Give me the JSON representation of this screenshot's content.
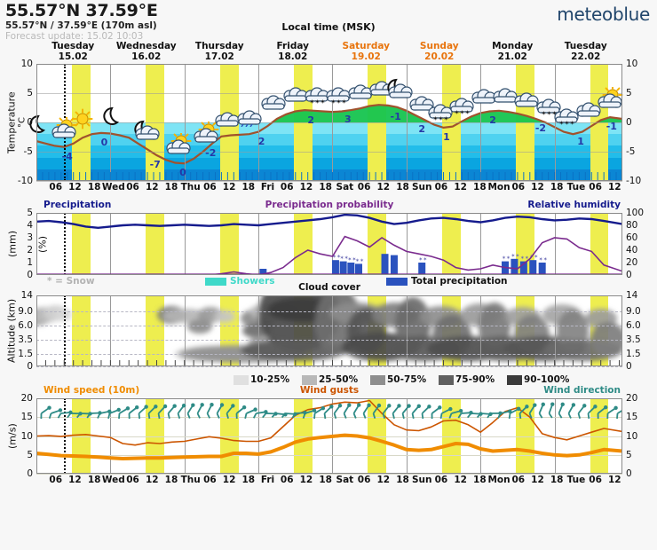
{
  "header": {
    "coordinates_main": "55.57°N 37.59°E",
    "coordinates_sub": "55.57°N / 37.59°E (170m asl)",
    "forecast_update": "Forecast update: 15.02 10:03",
    "local_time": "Local time (MSK)",
    "logo": "meteoblue"
  },
  "days": [
    {
      "name": "Tuesday",
      "date": "15.02",
      "weekend": false
    },
    {
      "name": "Wednesday",
      "date": "16.02",
      "weekend": false
    },
    {
      "name": "Thursday",
      "date": "17.02",
      "weekend": false
    },
    {
      "name": "Friday",
      "date": "18.02",
      "weekend": false
    },
    {
      "name": "Saturday",
      "date": "19.02",
      "weekend": true
    },
    {
      "name": "Sunday",
      "date": "20.02",
      "weekend": true
    },
    {
      "name": "Monday",
      "date": "21.02",
      "weekend": false
    },
    {
      "name": "Tuesday",
      "date": "22.02",
      "weekend": false
    }
  ],
  "xaxis": {
    "labels": [
      "06",
      "12",
      "18",
      "Wed",
      "06",
      "12",
      "18",
      "Thu",
      "06",
      "12",
      "18",
      "Fri",
      "06",
      "12",
      "18",
      "Sat",
      "06",
      "12",
      "18",
      "Sun",
      "06",
      "12",
      "18",
      "Mon",
      "06",
      "12",
      "18",
      "Tue",
      "06",
      "12"
    ],
    "positions_pct": [
      6.25,
      12.5,
      18.75,
      25,
      31.25,
      37.5,
      43.75,
      50,
      56.25,
      62.5,
      68.75,
      75,
      81.25,
      87.5,
      93.75,
      100,
      106.25,
      112.5,
      118.75,
      125,
      131.25,
      137.5,
      143.75,
      150,
      156.25,
      162.5,
      168.75,
      175,
      181.25,
      187.5
    ]
  },
  "colors": {
    "weekend_text": "#e8740c",
    "night_band": "#eeee4f",
    "temp_line": "#a0522d",
    "temp_label": "#2438a8",
    "humidity_line": "#151b8d",
    "precip_prob_line": "#7a2b8e",
    "precip_bar": "#2a52be",
    "showers": "#3fd9c9",
    "wind_speed": "#f08c00",
    "wind_gust": "#cc5500",
    "wind_barb": "#2e8b86",
    "logo": "#20456b"
  },
  "chart_data": [
    {
      "type": "line",
      "name": "temperature",
      "title": "Temperature",
      "ylabel": "Temperature",
      "yunit": "°C",
      "ylim": [
        -10,
        10
      ],
      "yticks": [
        -10,
        -5,
        0,
        5,
        10
      ],
      "ytick_labels": [
        "-10",
        "-5",
        "0",
        "5",
        "10"
      ],
      "xlabel": "",
      "grid": true,
      "legend": "none",
      "point_labels": [
        {
          "x_pct": 10.0,
          "value": "-4"
        },
        {
          "x_pct": 22.0,
          "value": "0"
        },
        {
          "x_pct": 38.5,
          "value": "-7"
        },
        {
          "x_pct": 47.5,
          "value": "0"
        },
        {
          "x_pct": 56.5,
          "value": "-2"
        },
        {
          "x_pct": 73.0,
          "value": "2"
        },
        {
          "x_pct": 89.0,
          "value": "2"
        },
        {
          "x_pct": 101.0,
          "value": "3"
        },
        {
          "x_pct": 116.5,
          "value": "-1"
        },
        {
          "x_pct": 125.0,
          "value": "2"
        },
        {
          "x_pct": 133.0,
          "value": "1"
        },
        {
          "x_pct": 148.0,
          "value": "2"
        },
        {
          "x_pct": 163.5,
          "value": "-2"
        },
        {
          "x_pct": 176.5,
          "value": "1"
        },
        {
          "x_pct": 186.5,
          "value": "-1"
        }
      ],
      "series": [
        {
          "name": "Temperature (°C)",
          "x_pct": [
            0,
            3,
            6,
            9,
            12,
            15,
            18,
            21,
            24,
            27,
            30,
            33,
            36,
            39,
            42,
            45,
            48,
            51,
            54,
            57,
            60,
            63,
            66,
            69,
            72,
            75,
            78,
            81,
            84,
            87,
            90,
            93,
            96,
            99,
            102,
            105,
            108,
            111,
            114,
            117,
            120,
            123,
            126,
            129,
            132,
            135,
            138,
            141,
            144,
            147,
            150,
            153,
            156,
            159,
            162,
            165,
            168,
            171,
            174,
            177,
            180,
            183,
            186,
            190
          ],
          "values": [
            -3.2,
            -3.6,
            -4.0,
            -4.2,
            -3.6,
            -2.6,
            -2.0,
            -1.8,
            -1.9,
            -2.2,
            -2.6,
            -3.6,
            -4.6,
            -5.6,
            -6.4,
            -6.9,
            -7.0,
            -6.2,
            -5.0,
            -3.6,
            -2.4,
            -2.2,
            -2.1,
            -2.0,
            -1.6,
            -0.6,
            0.6,
            1.4,
            1.9,
            2.1,
            2.0,
            1.9,
            1.8,
            1.9,
            2.1,
            2.4,
            2.8,
            3.0,
            2.9,
            2.6,
            2.0,
            1.2,
            0.4,
            -0.4,
            -0.9,
            -0.7,
            0.2,
            1.0,
            1.6,
            1.9,
            2.0,
            1.8,
            1.5,
            1.1,
            0.6,
            0.0,
            -0.8,
            -1.6,
            -2.0,
            -1.6,
            -0.6,
            0.4,
            0.9,
            0.6
          ]
        }
      ],
      "weather_icons": [
        {
          "x_pct": 2,
          "icon": "moon"
        },
        {
          "x_pct": 9,
          "icon": "sun-cloud"
        },
        {
          "x_pct": 15,
          "icon": "sun"
        },
        {
          "x_pct": 26,
          "icon": "moon"
        },
        {
          "x_pct": 36,
          "icon": "moon-cloud"
        },
        {
          "x_pct": 46,
          "icon": "sun-cloud"
        },
        {
          "x_pct": 55,
          "icon": "cloud-sun"
        },
        {
          "x_pct": 62,
          "icon": "cloud"
        },
        {
          "x_pct": 69,
          "icon": "cloud-rain"
        },
        {
          "x_pct": 77,
          "icon": "cloud"
        },
        {
          "x_pct": 84,
          "icon": "cloud"
        },
        {
          "x_pct": 91,
          "icon": "cloud-snow"
        },
        {
          "x_pct": 98,
          "icon": "cloud-snow"
        },
        {
          "x_pct": 105,
          "icon": "cloud"
        },
        {
          "x_pct": 112,
          "icon": "cloud"
        },
        {
          "x_pct": 118,
          "icon": "moon-cloud"
        },
        {
          "x_pct": 125,
          "icon": "cloud"
        },
        {
          "x_pct": 131,
          "icon": "cloud-snow"
        },
        {
          "x_pct": 138,
          "icon": "cloud-snow"
        },
        {
          "x_pct": 145,
          "icon": "cloud"
        },
        {
          "x_pct": 152,
          "icon": "cloud"
        },
        {
          "x_pct": 159,
          "icon": "cloud"
        },
        {
          "x_pct": 166,
          "icon": "cloud-snow"
        },
        {
          "x_pct": 172,
          "icon": "cloud-snow"
        },
        {
          "x_pct": 179,
          "icon": "cloud"
        },
        {
          "x_pct": 186,
          "icon": "sun-cloud"
        }
      ]
    },
    {
      "type": "line",
      "name": "precipitation",
      "title_left": "Precipitation",
      "title_center": "Precipitation probability",
      "title_right": "Relative humidity",
      "ylabel": "(mm)",
      "ylim": [
        0,
        5
      ],
      "yticks": [
        0,
        1,
        2,
        3,
        4,
        5
      ],
      "ytick_labels": [
        "0",
        "1",
        "2",
        "3",
        "4",
        "5"
      ],
      "y2label": "(%)",
      "y2lim": [
        0,
        100
      ],
      "y2ticks": [
        0,
        20,
        40,
        60,
        80,
        100
      ],
      "y2tick_labels": [
        "0",
        "20",
        "40",
        "60",
        "80",
        "100"
      ],
      "note": "* = Snow",
      "legend": [
        "Showers",
        "Total precipitation"
      ],
      "series": [
        {
          "name": "Relative humidity (%)",
          "color": "#151b8d",
          "x_pct": [
            0,
            4,
            8,
            12,
            16,
            20,
            24,
            28,
            32,
            36,
            40,
            44,
            48,
            52,
            56,
            60,
            64,
            68,
            72,
            76,
            80,
            84,
            88,
            92,
            96,
            100,
            104,
            108,
            112,
            116,
            120,
            124,
            128,
            132,
            136,
            140,
            144,
            148,
            152,
            156,
            160,
            164,
            168,
            172,
            176,
            180,
            184,
            190
          ],
          "values": [
            86,
            87,
            85,
            82,
            78,
            76,
            78,
            80,
            81,
            80,
            79,
            80,
            81,
            80,
            79,
            80,
            82,
            81,
            80,
            82,
            84,
            86,
            88,
            90,
            93,
            97,
            96,
            92,
            86,
            82,
            84,
            88,
            91,
            92,
            90,
            87,
            85,
            88,
            92,
            94,
            93,
            90,
            88,
            89,
            91,
            90,
            87,
            82
          ]
        },
        {
          "name": "Precipitation probability (%)",
          "color": "#7a2b8e",
          "x_pct": [
            0,
            4,
            8,
            12,
            16,
            20,
            24,
            28,
            32,
            36,
            40,
            44,
            48,
            52,
            56,
            60,
            64,
            68,
            72,
            76,
            80,
            84,
            88,
            92,
            96,
            100,
            104,
            108,
            112,
            116,
            120,
            124,
            128,
            132,
            136,
            140,
            144,
            148,
            152,
            156,
            160,
            164,
            168,
            172,
            176,
            180,
            184,
            190
          ],
          "values": [
            0,
            0,
            0,
            0,
            0,
            0,
            0,
            0,
            0,
            0,
            0,
            0,
            0,
            0,
            0,
            2,
            5,
            2,
            0,
            4,
            12,
            28,
            40,
            34,
            30,
            62,
            55,
            45,
            60,
            48,
            38,
            34,
            30,
            24,
            12,
            8,
            10,
            16,
            12,
            10,
            26,
            52,
            60,
            58,
            44,
            38,
            16,
            6
          ]
        }
      ],
      "bars": [
        {
          "x_pct": 73.5,
          "value_mm": 0.5,
          "snow": false
        },
        {
          "x_pct": 97.0,
          "value_mm": 1.2,
          "snow": true
        },
        {
          "x_pct": 99.5,
          "value_mm": 1.1,
          "snow": true
        },
        {
          "x_pct": 102.0,
          "value_mm": 1.0,
          "snow": true
        },
        {
          "x_pct": 104.5,
          "value_mm": 0.9,
          "snow": true
        },
        {
          "x_pct": 113.0,
          "value_mm": 1.7,
          "snow": false
        },
        {
          "x_pct": 116.0,
          "value_mm": 1.6,
          "snow": false
        },
        {
          "x_pct": 125.0,
          "value_mm": 1.0,
          "snow": true
        },
        {
          "x_pct": 152.0,
          "value_mm": 1.1,
          "snow": true
        },
        {
          "x_pct": 155.0,
          "value_mm": 1.3,
          "snow": true
        },
        {
          "x_pct": 158.0,
          "value_mm": 1.1,
          "snow": true
        },
        {
          "x_pct": 161.0,
          "value_mm": 1.2,
          "snow": true
        },
        {
          "x_pct": 164.0,
          "value_mm": 1.0,
          "snow": true
        }
      ]
    },
    {
      "type": "heatmap",
      "name": "cloud-cover",
      "title": "Cloud cover",
      "ylabel": "Altitude (km)",
      "ylim": [
        0,
        14
      ],
      "yticks": [
        0,
        1.5,
        3.5,
        6.0,
        9.0,
        14
      ],
      "ytick_labels": [
        "0",
        "1.5",
        "3.5",
        "6.0",
        "9.0",
        "14"
      ],
      "legend_title": "Cloud cover",
      "legend": [
        {
          "label": "10-25%",
          "color": "#e0e0e0"
        },
        {
          "label": "25-50%",
          "color": "#b8b8b8"
        },
        {
          "label": "50-75%",
          "color": "#8e8e8e"
        },
        {
          "label": "75-90%",
          "color": "#606060"
        },
        {
          "label": "90-100%",
          "color": "#3a3a3a"
        }
      ]
    },
    {
      "type": "line",
      "name": "wind",
      "title_left": "Wind speed (10m)",
      "title_center": "Wind gusts",
      "title_right": "Wind direction",
      "ylabel": "(m/s)",
      "ylim": [
        0,
        20
      ],
      "yticks": [
        0,
        5,
        10,
        15,
        20
      ],
      "ytick_labels": [
        "0",
        "5",
        "10",
        "15",
        "20"
      ],
      "series": [
        {
          "name": "Wind gusts (m/s)",
          "color": "#cc5500",
          "x_pct": [
            0,
            4,
            8,
            12,
            16,
            20,
            24,
            28,
            32,
            36,
            40,
            44,
            48,
            52,
            56,
            60,
            64,
            68,
            72,
            76,
            80,
            84,
            88,
            92,
            96,
            100,
            104,
            108,
            112,
            116,
            120,
            124,
            128,
            132,
            136,
            140,
            144,
            148,
            152,
            156,
            160,
            164,
            168,
            172,
            176,
            180,
            184,
            190
          ],
          "values": [
            10.0,
            10.1,
            9.9,
            10.2,
            10.4,
            10.0,
            9.6,
            8.0,
            7.6,
            8.2,
            8.0,
            8.4,
            8.6,
            9.2,
            9.8,
            9.4,
            8.8,
            8.6,
            8.6,
            9.5,
            12.5,
            15.5,
            17.0,
            17.5,
            18.5,
            19.0,
            18.8,
            19.4,
            16.0,
            13.0,
            11.6,
            11.4,
            12.4,
            14.0,
            14.2,
            13.0,
            11.0,
            13.6,
            16.5,
            17.5,
            15.0,
            10.6,
            9.6,
            9.0,
            10.0,
            11.0,
            12.0,
            11.2
          ]
        },
        {
          "name": "Wind speed (10m, m/s)",
          "color": "#f08c00",
          "x_pct": [
            0,
            4,
            8,
            12,
            16,
            20,
            24,
            28,
            32,
            36,
            40,
            44,
            48,
            52,
            56,
            60,
            64,
            68,
            72,
            76,
            80,
            84,
            88,
            92,
            96,
            100,
            104,
            108,
            112,
            116,
            120,
            124,
            128,
            132,
            136,
            140,
            144,
            148,
            152,
            156,
            160,
            164,
            168,
            172,
            176,
            180,
            184,
            190
          ],
          "values": [
            5.4,
            5.1,
            4.8,
            4.7,
            4.6,
            4.4,
            4.2,
            4.0,
            4.1,
            4.2,
            4.2,
            4.3,
            4.4,
            4.5,
            4.6,
            4.6,
            5.4,
            5.4,
            5.2,
            5.8,
            7.0,
            8.4,
            9.2,
            9.6,
            9.9,
            10.2,
            10.0,
            9.5,
            8.6,
            7.6,
            6.4,
            6.2,
            6.4,
            7.2,
            8.0,
            7.8,
            6.6,
            6.0,
            6.2,
            6.4,
            6.0,
            5.4,
            5.0,
            4.8,
            5.0,
            5.6,
            6.4,
            6.0
          ]
        }
      ],
      "wind_barbs_count": 60
    }
  ]
}
